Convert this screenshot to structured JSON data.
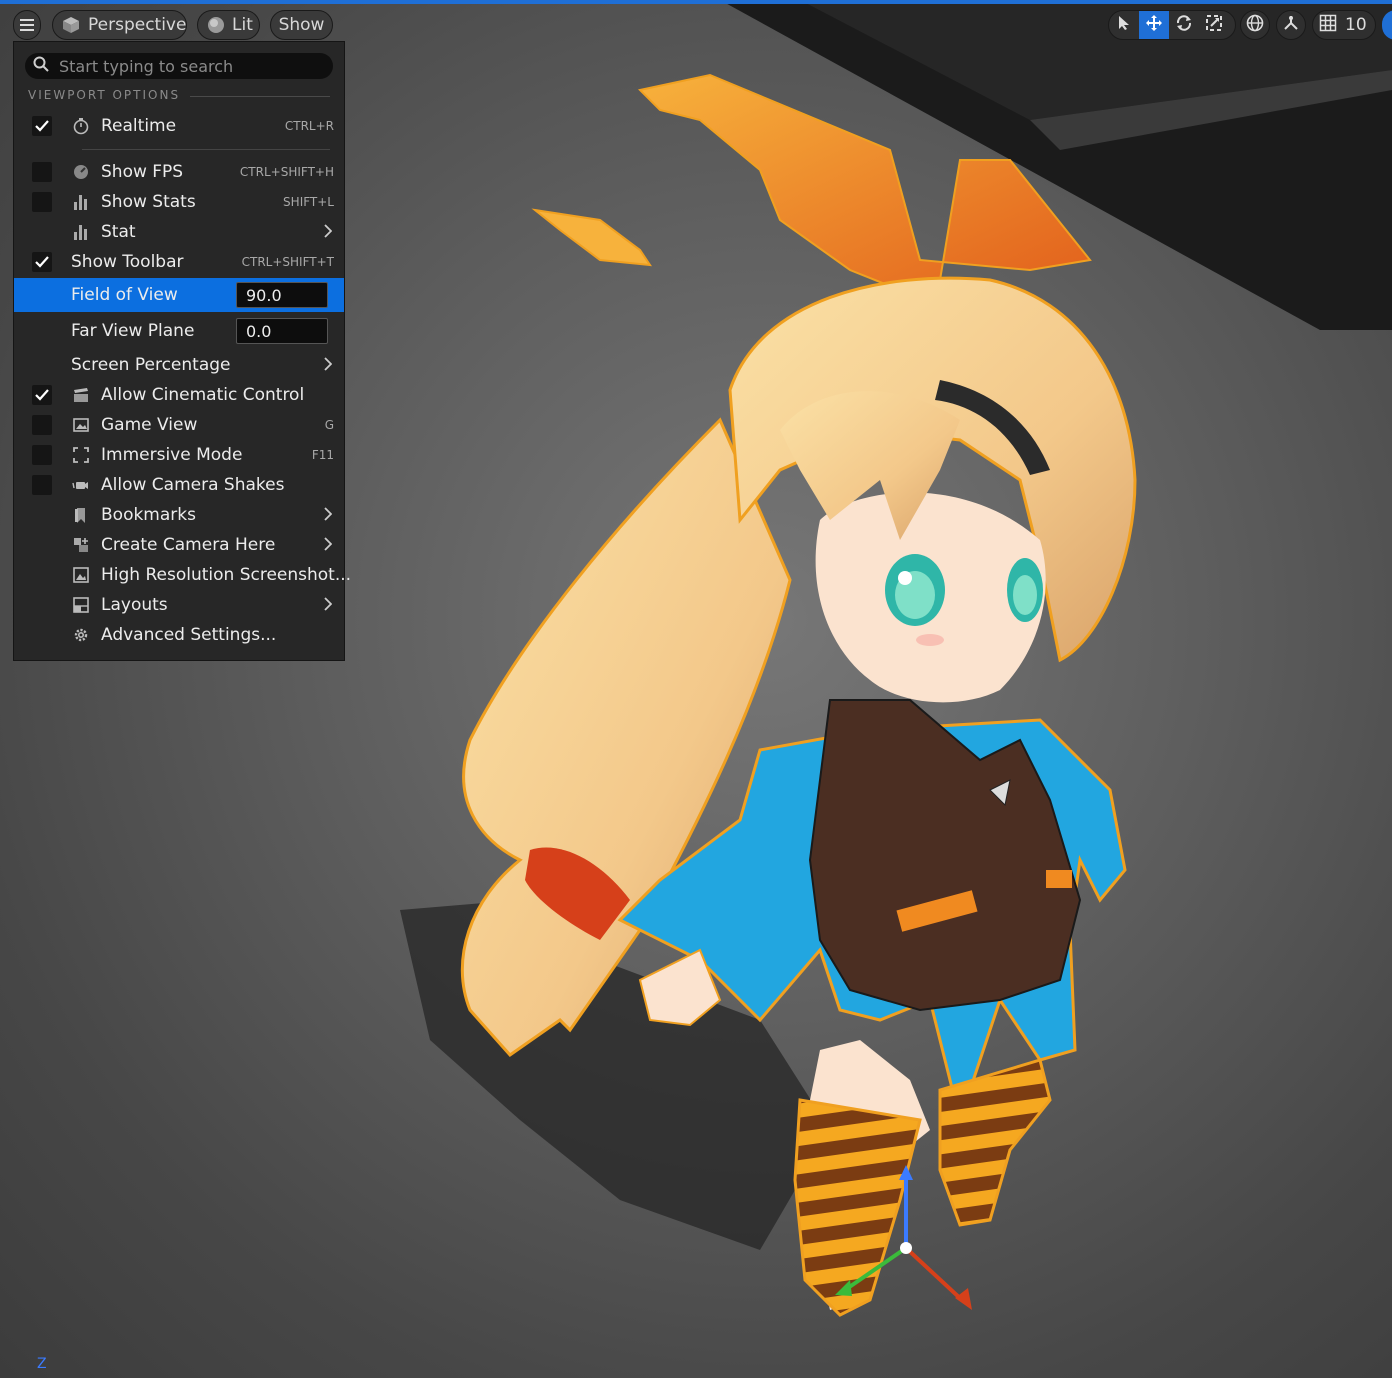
{
  "toolbar": {
    "menu_icon": "hamburger-icon",
    "perspective_label": "Perspective",
    "lit_label": "Lit",
    "show_label": "Show",
    "grid_snap_value": "10",
    "right_icons": [
      "select-arrow-icon",
      "translate-icon",
      "rotate-icon",
      "scale-icon",
      "world-globe-icon",
      "surface-snap-icon",
      "grid-icon"
    ]
  },
  "menu": {
    "search_placeholder": "Start typing to search",
    "section_title": "VIEWPORT OPTIONS",
    "items": [
      {
        "label": "Realtime",
        "checked": true,
        "icon": "stopwatch-icon",
        "shortcut": "CTRL+R"
      },
      {
        "label": "Show FPS",
        "checked": false,
        "icon": "fps-gauge-icon",
        "shortcut": "CTRL+SHIFT+H"
      },
      {
        "label": "Show Stats",
        "checked": false,
        "icon": "bar-chart-icon",
        "shortcut": "SHIFT+L"
      },
      {
        "label": "Stat",
        "icon": "bar-chart-icon",
        "submenu": true
      },
      {
        "label": "Show Toolbar",
        "checked": true,
        "shortcut": "CTRL+SHIFT+T"
      },
      {
        "label": "Field of View",
        "value": "90.0"
      },
      {
        "label": "Far View Plane",
        "value": "0.0"
      },
      {
        "label": "Screen Percentage",
        "submenu": true
      },
      {
        "label": "Allow Cinematic Control",
        "checked": true,
        "icon": "clapperboard-icon"
      },
      {
        "label": "Game View",
        "checked": false,
        "icon": "game-view-icon",
        "shortcut": "G"
      },
      {
        "label": "Immersive Mode",
        "checked": false,
        "icon": "fullscreen-corners-icon",
        "shortcut": "F11"
      },
      {
        "label": "Allow Camera Shakes",
        "checked": false,
        "icon": "camera-shake-icon"
      },
      {
        "label": "Bookmarks",
        "icon": "bookmark-icon",
        "submenu": true
      },
      {
        "label": "Create Camera Here",
        "icon": "create-camera-icon",
        "submenu": true
      },
      {
        "label": "High Resolution Screenshot...",
        "icon": "screenshot-icon"
      },
      {
        "label": "Layouts",
        "icon": "layout-icon",
        "submenu": true
      },
      {
        "label": "Advanced Settings...",
        "icon": "gear-icon"
      }
    ]
  },
  "viewport": {
    "axis_label": "Z",
    "accent_color": "#0c6fe0",
    "selection_outline_color": "#f0a020"
  }
}
